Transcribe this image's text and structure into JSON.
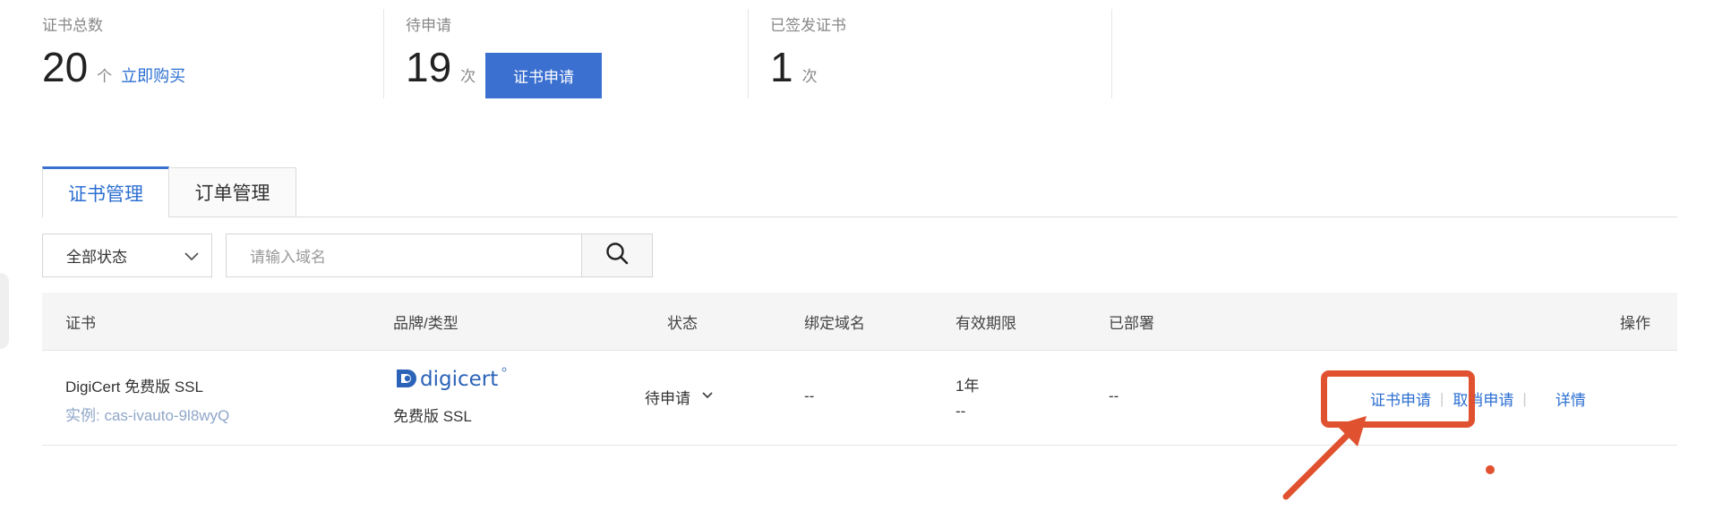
{
  "stats": {
    "total": {
      "label": "证书总数",
      "value": "20",
      "unit": "个",
      "link": "立即购买"
    },
    "pending": {
      "label": "待申请",
      "value": "19",
      "unit": "次",
      "button": "证书申请"
    },
    "issued": {
      "label": "已签发证书",
      "value": "1",
      "unit": "次"
    }
  },
  "tabs": [
    {
      "label": "证书管理",
      "active": true
    },
    {
      "label": "订单管理",
      "active": false
    }
  ],
  "filters": {
    "status_select": "全部状态",
    "search_placeholder": "请输入域名"
  },
  "table": {
    "columns": [
      "证书",
      "品牌/类型",
      "状态",
      "绑定域名",
      "有效期限",
      "已部署",
      "操作"
    ],
    "rows": [
      {
        "name": "DigiCert 免费版 SSL",
        "instance": "实例: cas-ivauto-9l8wyQ",
        "brand_logo": "digicert",
        "type": "免费版 SSL",
        "status": "待申请",
        "domain": "--",
        "validity": "1年",
        "validity_sub": "--",
        "deployed": "--",
        "actions": [
          "证书申请",
          "取消申请",
          "详情"
        ]
      }
    ]
  },
  "colors": {
    "primary": "#3b70d0",
    "link": "#2c6fd1",
    "annotation": "#e0522f"
  },
  "icons": [
    "chevron-down-icon",
    "search-icon",
    "arrow-annotation-icon"
  ]
}
